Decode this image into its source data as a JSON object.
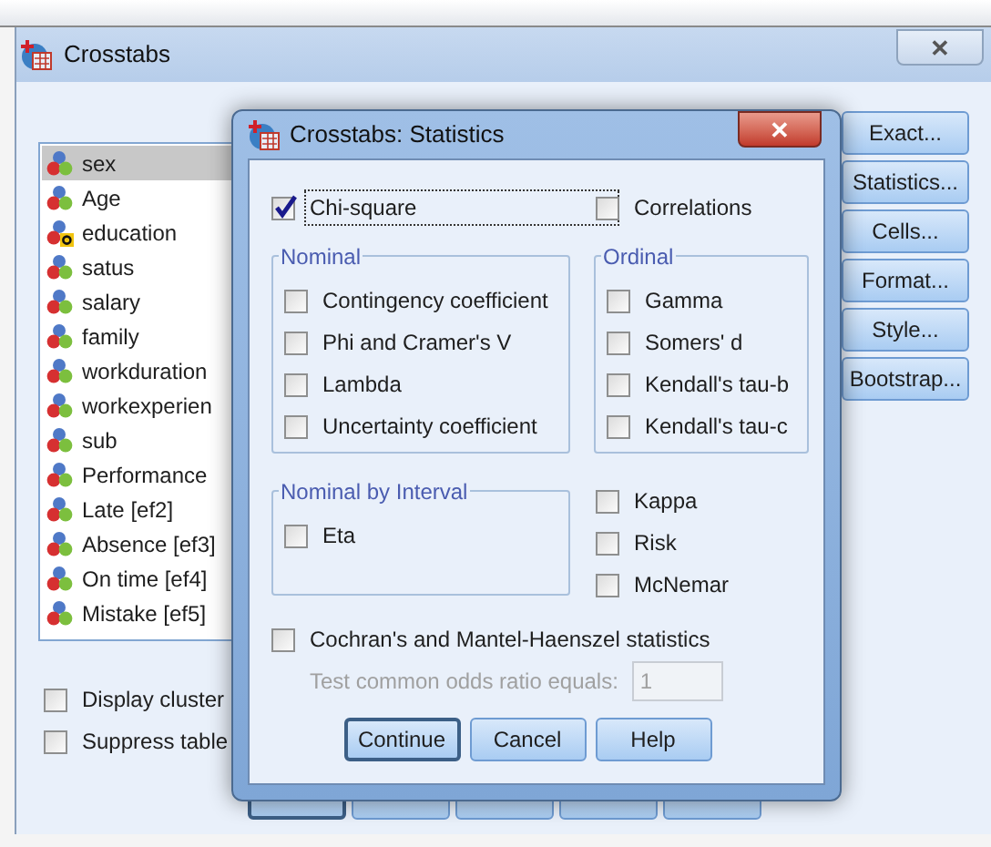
{
  "window": {
    "title": "Crosstabs",
    "close": "✕"
  },
  "variables": [
    {
      "name": "sex",
      "kind": "numeric",
      "selected": true
    },
    {
      "name": "Age",
      "kind": "numeric",
      "selected": false
    },
    {
      "name": "education",
      "kind": "string",
      "selected": false
    },
    {
      "name": "satus",
      "kind": "numeric",
      "selected": false
    },
    {
      "name": "salary",
      "kind": "numeric",
      "selected": false
    },
    {
      "name": "family",
      "kind": "numeric",
      "selected": false
    },
    {
      "name": "workduration",
      "kind": "numeric",
      "selected": false
    },
    {
      "name": "workexperien",
      "kind": "numeric",
      "selected": false
    },
    {
      "name": "sub",
      "kind": "numeric",
      "selected": false
    },
    {
      "name": "Performance",
      "kind": "numeric",
      "selected": false
    },
    {
      "name": "Late [ef2]",
      "kind": "numeric",
      "selected": false
    },
    {
      "name": "Absence [ef3]",
      "kind": "numeric",
      "selected": false
    },
    {
      "name": "On time [ef4]",
      "kind": "numeric",
      "selected": false
    },
    {
      "name": "Mistake [ef5]",
      "kind": "numeric",
      "selected": false
    }
  ],
  "side_buttons": [
    "Exact...",
    "Statistics...",
    "Cells...",
    "Format...",
    "Style...",
    "Bootstrap..."
  ],
  "options": [
    {
      "label": "Display cluster",
      "checked": false
    },
    {
      "label": "Suppress table",
      "checked": false
    }
  ],
  "bottom_buttons": [
    {
      "default": true
    },
    {
      "default": false
    },
    {
      "default": false
    },
    {
      "default": false
    },
    {
      "default": false
    }
  ],
  "statistics_dialog": {
    "title": "Crosstabs: Statistics",
    "close": "✕",
    "top": [
      {
        "label": "Chi-square",
        "checked": true,
        "focused": true
      },
      {
        "label": "Correlations",
        "checked": false,
        "focused": false
      }
    ],
    "nominal": {
      "title": "Nominal",
      "items": [
        {
          "label": "Contingency coefficient",
          "checked": false
        },
        {
          "label": "Phi and Cramer's V",
          "checked": false
        },
        {
          "label": "Lambda",
          "checked": false
        },
        {
          "label": "Uncertainty coefficient",
          "checked": false
        }
      ]
    },
    "ordinal": {
      "title": "Ordinal",
      "items": [
        {
          "label": "Gamma",
          "checked": false
        },
        {
          "label": "Somers' d",
          "checked": false
        },
        {
          "label": "Kendall's tau-b",
          "checked": false
        },
        {
          "label": "Kendall's tau-c",
          "checked": false
        }
      ]
    },
    "nominal_by_interval": {
      "title": "Nominal by Interval",
      "items": [
        {
          "label": "Eta",
          "checked": false
        }
      ]
    },
    "other": [
      {
        "label": "Kappa",
        "checked": false
      },
      {
        "label": "Risk",
        "checked": false
      },
      {
        "label": "McNemar",
        "checked": false
      }
    ],
    "cmh": {
      "label": "Cochran's and Mantel-Haenszel statistics",
      "checked": false
    },
    "odds_ratio": {
      "label": "Test common odds ratio equals:",
      "value": "1",
      "disabled": true
    },
    "buttons": [
      {
        "label": "Continue",
        "default": true
      },
      {
        "label": "Cancel",
        "default": false
      },
      {
        "label": "Help",
        "default": false
      }
    ]
  }
}
